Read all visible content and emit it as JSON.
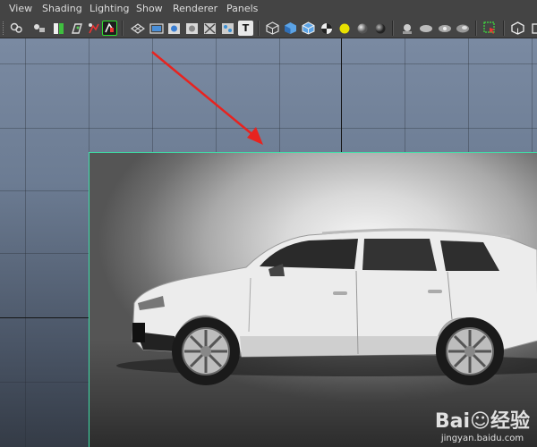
{
  "menubar": {
    "items": [
      {
        "label": "View"
      },
      {
        "label": "Shading"
      },
      {
        "label": "Lighting"
      },
      {
        "label": "Show"
      },
      {
        "label": "Renderer"
      },
      {
        "label": "Panels"
      }
    ]
  },
  "toolbar": {
    "text_tool_glyph": "T",
    "icons": [
      "camera-select-icon",
      "camera-attributes-icon",
      "bookmark-icon",
      "image-plane-icon",
      "grease-pencil-icon",
      "film-gate-icon",
      "grid-icon",
      "resolution-gate-icon",
      "gate-mask-icon",
      "field-chart-icon",
      "safe-action-icon",
      "safe-title-icon",
      "text-icon",
      "wireframe-icon",
      "smooth-shade-icon",
      "wireframe-on-shaded-icon",
      "checker-icon",
      "lights-icon",
      "shadows-icon",
      "ambient-occlusion-icon",
      "isolate-select-icon",
      "xray-icon",
      "xray-joints-icon",
      "backface-icon",
      "select-highlight-icon",
      "camera-icon",
      "viewport-icon"
    ]
  },
  "viewport": {
    "image_plane": {
      "description_hidden": ""
    }
  },
  "watermark": {
    "logo": "Bai☺经验",
    "url": "jingyan.baidu.com"
  },
  "colors": {
    "menu_bg": "#444444",
    "image_plane_border": "#3fe0a8",
    "arrow": "#e8231f"
  }
}
